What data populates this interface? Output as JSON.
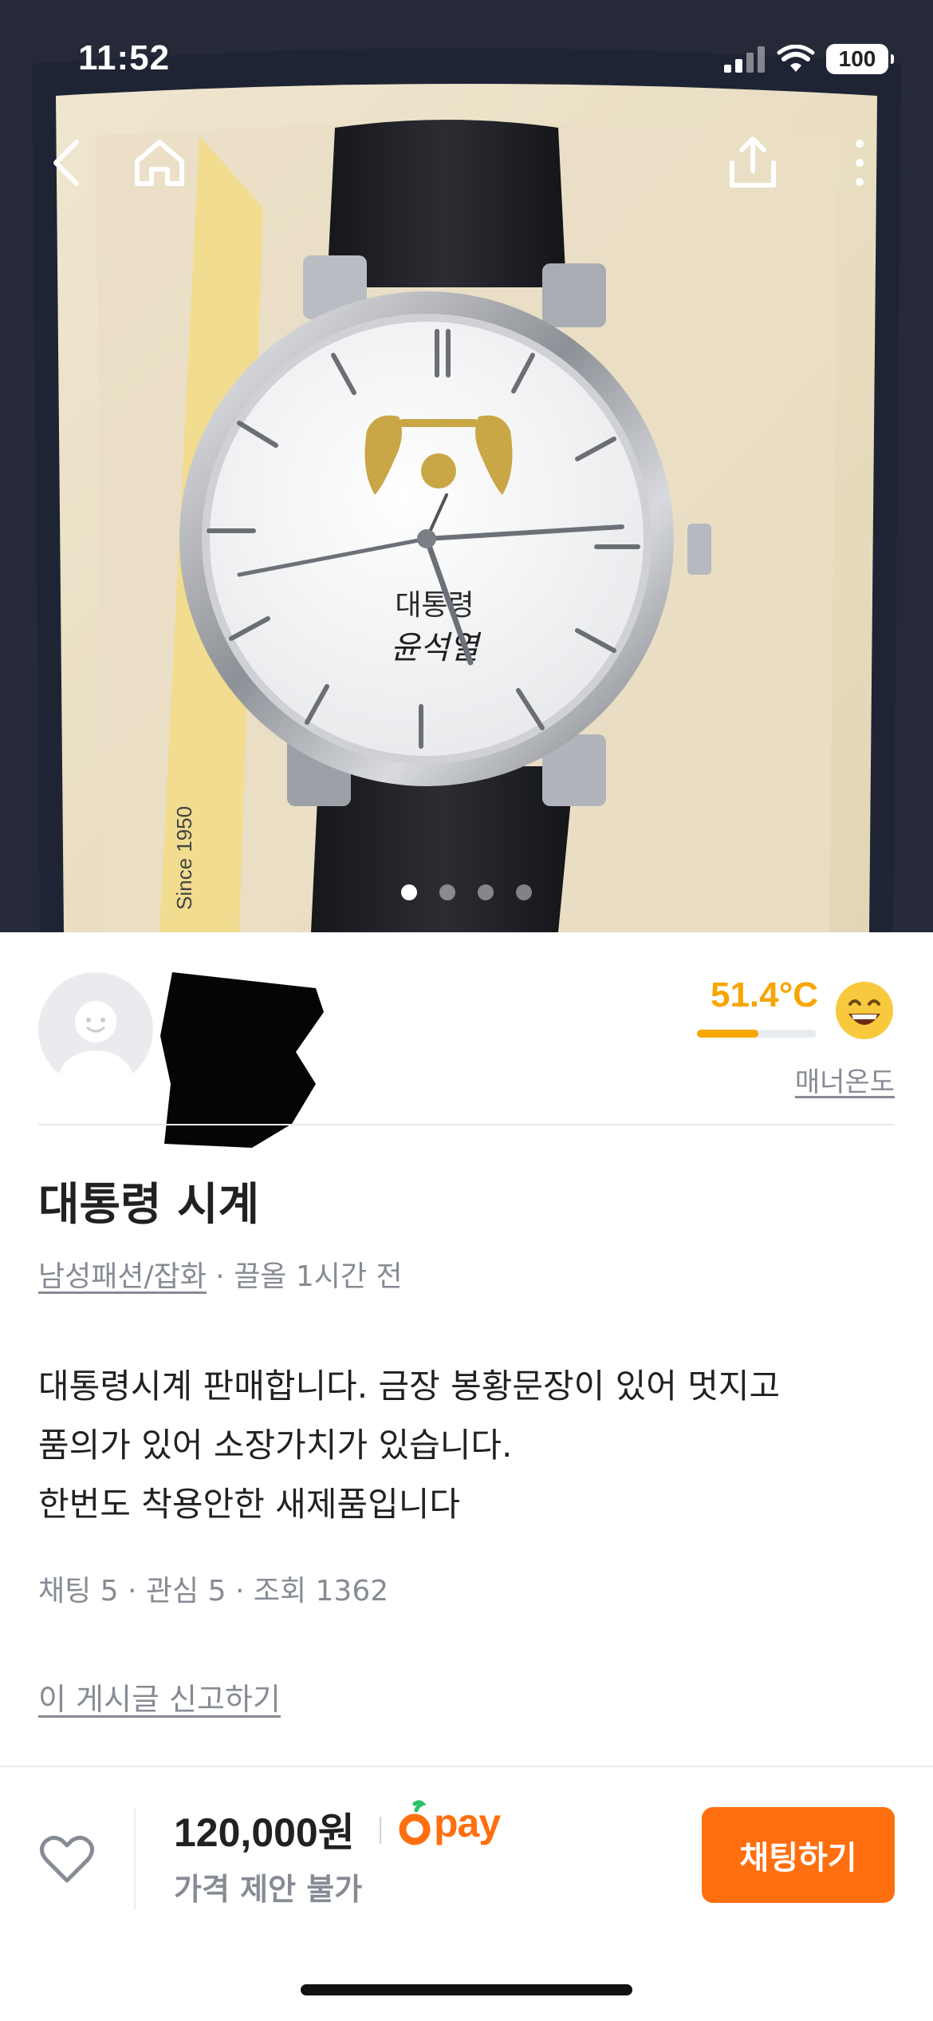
{
  "status_bar": {
    "time": "11:52",
    "battery": "100"
  },
  "photo": {
    "dial_text_1": "대통령",
    "dial_text_2": "윤석열",
    "box_text": "Since 1950",
    "image_count": 4,
    "current_index": 1
  },
  "seller": {
    "temperature": "51.4°C",
    "temperature_level": 0.514,
    "manner_label": "매너온도"
  },
  "item": {
    "title": "대통령 시계",
    "category": "남성패션/잡화",
    "posted": " · 끌올 1시간 전",
    "description": [
      "대통령시계 판매합니다. 금장 봉황문장이 있어 멋지고",
      "품의가 있어 소장가치가 있습니다.",
      "한번도 착용안한 새제품입니다"
    ],
    "stats": "채팅 5 · 관심 5 · 조회 1362",
    "report_label": "이 게시글 신고하기"
  },
  "bottom_bar": {
    "price": "120,000원",
    "pay_label": "pay",
    "negotiation": "가격 제안 불가",
    "chat_button": "채팅하기"
  },
  "colors": {
    "accent": "#ff6f0f",
    "temperature": "#f7a600",
    "muted": "#868b94"
  }
}
